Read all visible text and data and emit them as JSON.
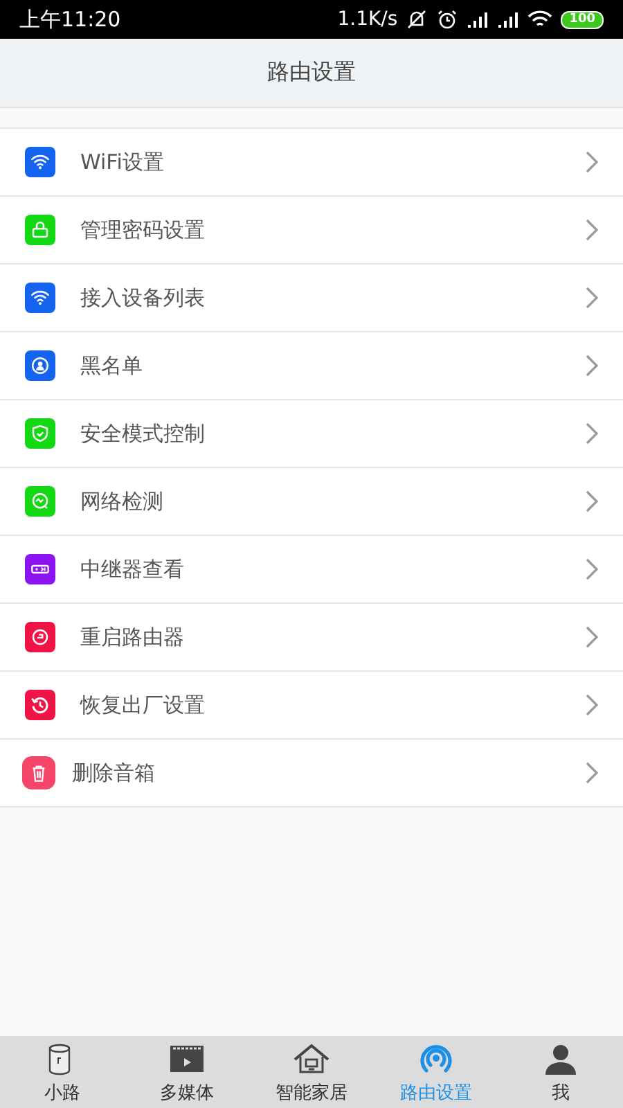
{
  "status_bar": {
    "time": "上午11:20",
    "speed": "1.1K/s",
    "battery": "100"
  },
  "header": {
    "title": "路由设置"
  },
  "items": [
    {
      "label": "WiFi设置",
      "kind": "wifi",
      "color": "#1464f0"
    },
    {
      "label": "管理密码设置",
      "kind": "lock",
      "color": "#14d814"
    },
    {
      "label": "接入设备列表",
      "kind": "wifi",
      "color": "#1464f0"
    },
    {
      "label": "黑名单",
      "kind": "user",
      "color": "#1464f0"
    },
    {
      "label": "安全模式控制",
      "kind": "shield",
      "color": "#14d814"
    },
    {
      "label": "网络检测",
      "kind": "monitor",
      "color": "#14d814"
    },
    {
      "label": "中继器查看",
      "kind": "relay",
      "color": "#8c14f0"
    },
    {
      "label": "重启路由器",
      "kind": "restart",
      "color": "#f01446"
    },
    {
      "label": "恢复出厂设置",
      "kind": "reset",
      "color": "#f01446"
    },
    {
      "label": "删除音箱",
      "kind": "trash",
      "color": "#f54669"
    }
  ],
  "tabs": [
    {
      "label": "小路",
      "kind": "speaker",
      "selected": false
    },
    {
      "label": "多媒体",
      "kind": "media",
      "selected": false
    },
    {
      "label": "智能家居",
      "kind": "home",
      "selected": false
    },
    {
      "label": "路由设置",
      "kind": "router",
      "selected": true
    },
    {
      "label": "我",
      "kind": "person",
      "selected": false
    }
  ]
}
